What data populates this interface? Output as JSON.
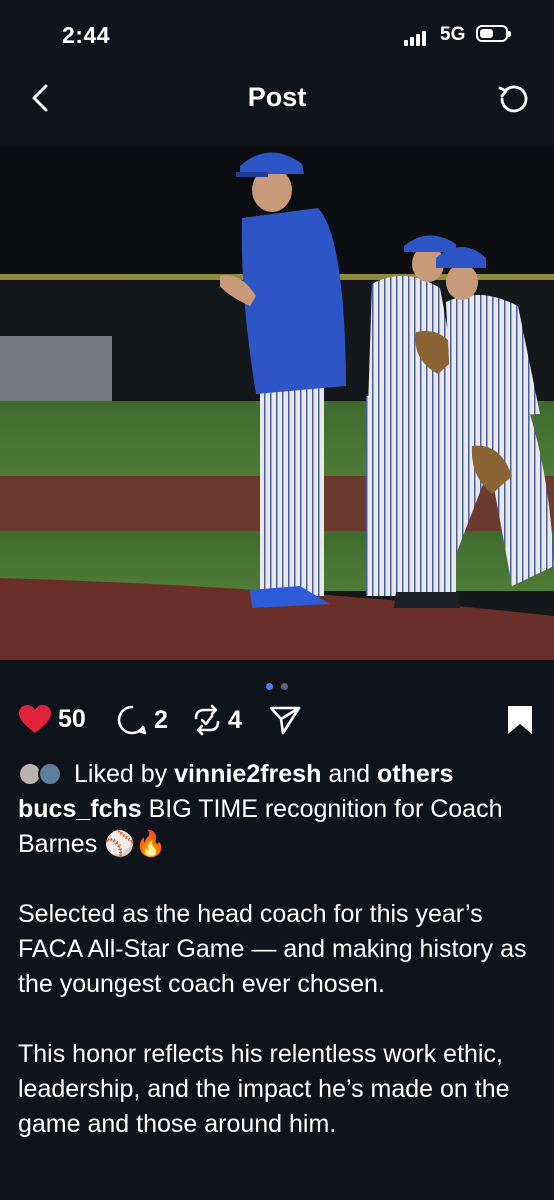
{
  "status_bar": {
    "time": "2:44",
    "network": "5G",
    "battery_level": 0.55
  },
  "nav": {
    "title": "Post",
    "back_icon": "chevron-left-icon",
    "refresh_icon": "refresh-icon"
  },
  "photo": {
    "description_icon": "baseball-photo",
    "carousel": {
      "count": 2,
      "active_index": 0,
      "active_color": "#4a7bf0",
      "inactive_color": "#5b6270"
    }
  },
  "actions": {
    "like_count": "50",
    "comment_count": "2",
    "repost_count": "4",
    "like_color": "#e0223b"
  },
  "post": {
    "liked_by_prefix": "Liked by",
    "liked_by_user": "vinnie2fresh",
    "liked_by_and": "and",
    "liked_by_others": "others",
    "username": "bucs_fchs",
    "caption_line1": "BIG TIME recognition for Coach Barnes ⚾️🔥",
    "paragraph1": "Selected as the head coach for this year’s FACA All-Star Game — and making history as the youngest coach ever chosen.",
    "paragraph2": "This honor reflects his relentless work ethic, leadership, and the impact he’s made on the game and those around him."
  }
}
